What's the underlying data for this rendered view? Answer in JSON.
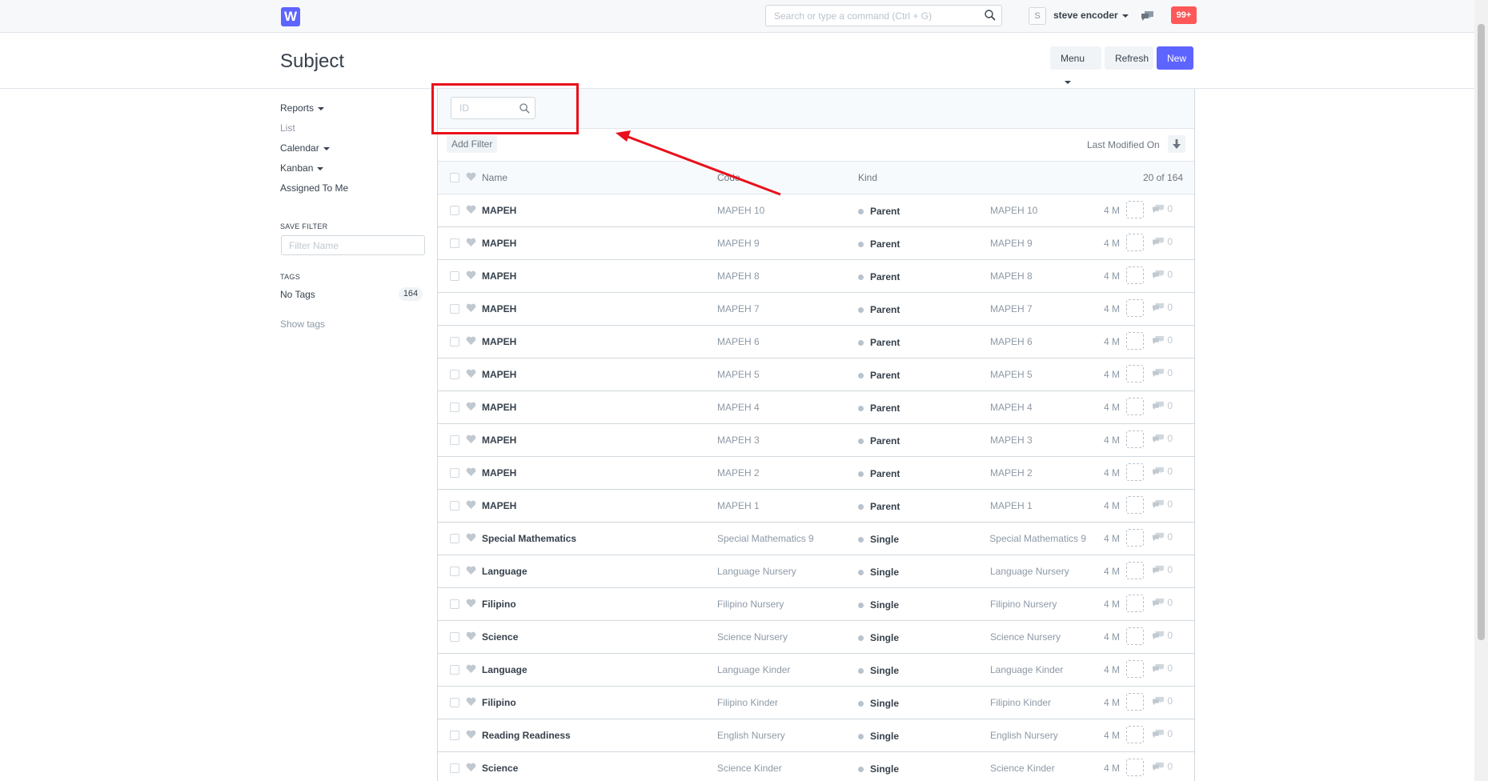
{
  "navbar": {
    "logo": "W",
    "search_placeholder": "Search or type a command (Ctrl + G)",
    "avatar_initial": "S",
    "user_name": "steve encoder",
    "notifications": "99+"
  },
  "page": {
    "title": "Subject",
    "menu_label": "Menu",
    "refresh_label": "Refresh",
    "new_label": "New"
  },
  "sidebar": {
    "reports": "Reports",
    "list": "List",
    "calendar": "Calendar",
    "kanban": "Kanban",
    "assigned_to_me": "Assigned To Me",
    "save_filter_caption": "SAVE FILTER",
    "filter_name_placeholder": "Filter Name",
    "tags_caption": "TAGS",
    "no_tags": "No Tags",
    "no_tags_count": "164",
    "show_tags": "Show tags"
  },
  "filters": {
    "id_placeholder": "ID",
    "add_filter": "Add Filter",
    "sort_label": "Last Modified On"
  },
  "list": {
    "columns": {
      "name": "Name",
      "code": "Code",
      "kind": "Kind"
    },
    "count": "20 of 164",
    "rows": [
      {
        "name": "MAPEH",
        "code": "MAPEH 10",
        "kind": "Parent",
        "title": "MAPEH 10",
        "modified": "4 M",
        "comments": "0"
      },
      {
        "name": "MAPEH",
        "code": "MAPEH 9",
        "kind": "Parent",
        "title": "MAPEH 9",
        "modified": "4 M",
        "comments": "0"
      },
      {
        "name": "MAPEH",
        "code": "MAPEH 8",
        "kind": "Parent",
        "title": "MAPEH 8",
        "modified": "4 M",
        "comments": "0"
      },
      {
        "name": "MAPEH",
        "code": "MAPEH 7",
        "kind": "Parent",
        "title": "MAPEH 7",
        "modified": "4 M",
        "comments": "0"
      },
      {
        "name": "MAPEH",
        "code": "MAPEH 6",
        "kind": "Parent",
        "title": "MAPEH 6",
        "modified": "4 M",
        "comments": "0"
      },
      {
        "name": "MAPEH",
        "code": "MAPEH 5",
        "kind": "Parent",
        "title": "MAPEH 5",
        "modified": "4 M",
        "comments": "0"
      },
      {
        "name": "MAPEH",
        "code": "MAPEH 4",
        "kind": "Parent",
        "title": "MAPEH 4",
        "modified": "4 M",
        "comments": "0"
      },
      {
        "name": "MAPEH",
        "code": "MAPEH 3",
        "kind": "Parent",
        "title": "MAPEH 3",
        "modified": "4 M",
        "comments": "0"
      },
      {
        "name": "MAPEH",
        "code": "MAPEH 2",
        "kind": "Parent",
        "title": "MAPEH 2",
        "modified": "4 M",
        "comments": "0"
      },
      {
        "name": "MAPEH",
        "code": "MAPEH 1",
        "kind": "Parent",
        "title": "MAPEH 1",
        "modified": "4 M",
        "comments": "0"
      },
      {
        "name": "Special Mathematics",
        "code": "Special Mathematics 9",
        "kind": "Single",
        "title": "Special Mathematics 9",
        "modified": "4 M",
        "comments": "0"
      },
      {
        "name": "Language",
        "code": "Language Nursery",
        "kind": "Single",
        "title": "Language Nursery",
        "modified": "4 M",
        "comments": "0"
      },
      {
        "name": "Filipino",
        "code": "Filipino Nursery",
        "kind": "Single",
        "title": "Filipino Nursery",
        "modified": "4 M",
        "comments": "0"
      },
      {
        "name": "Science",
        "code": "Science Nursery",
        "kind": "Single",
        "title": "Science Nursery",
        "modified": "4 M",
        "comments": "0"
      },
      {
        "name": "Language",
        "code": "Language Kinder",
        "kind": "Single",
        "title": "Language Kinder",
        "modified": "4 M",
        "comments": "0"
      },
      {
        "name": "Filipino",
        "code": "Filipino Kinder",
        "kind": "Single",
        "title": "Filipino Kinder",
        "modified": "4 M",
        "comments": "0"
      },
      {
        "name": "Reading Readiness",
        "code": "English Nursery",
        "kind": "Single",
        "title": "English Nursery",
        "modified": "4 M",
        "comments": "0"
      },
      {
        "name": "Science",
        "code": "Science Kinder",
        "kind": "Single",
        "title": "Science Kinder",
        "modified": "4 M",
        "comments": "0"
      }
    ]
  },
  "colors": {
    "primary": "#5e64ff",
    "badge": "#ff5858",
    "annotation": "#e8101b"
  }
}
